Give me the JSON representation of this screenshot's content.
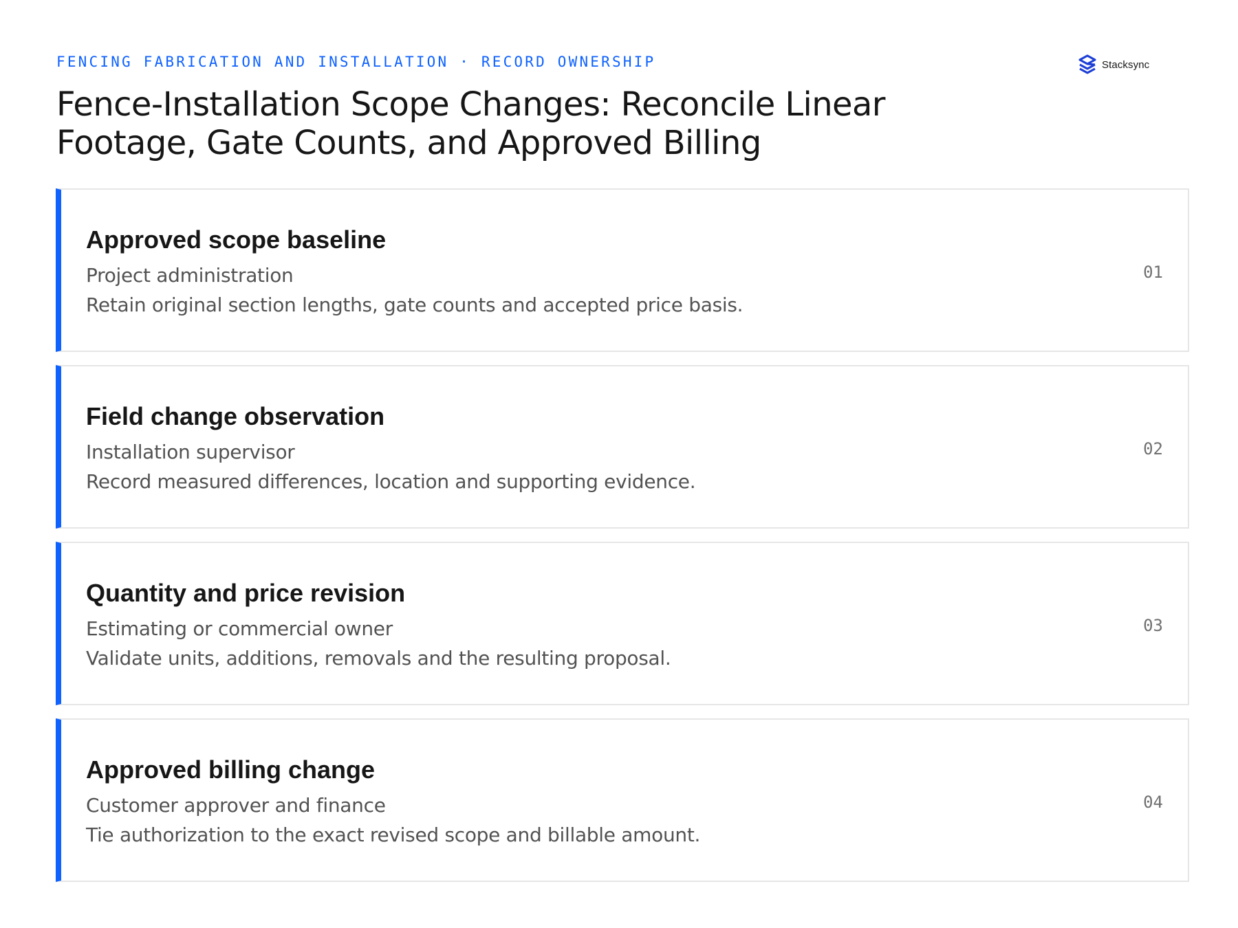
{
  "header": {
    "eyebrow": "FENCING FABRICATION AND INSTALLATION · RECORD OWNERSHIP",
    "title": "Fence-Installation Scope Changes: Reconcile Linear Footage, Gate Counts, and Approved Billing"
  },
  "brand": {
    "name": "Stacksync",
    "icon": "stacksync-logo-icon",
    "accent_color": "#0f62fe"
  },
  "steps": [
    {
      "number": "01",
      "title": "Approved scope baseline",
      "owner": "Project administration",
      "description": "Retain original section lengths, gate counts and accepted price basis."
    },
    {
      "number": "02",
      "title": "Field change observation",
      "owner": "Installation supervisor",
      "description": "Record measured differences, location and supporting evidence."
    },
    {
      "number": "03",
      "title": "Quantity and price revision",
      "owner": "Estimating or commercial owner",
      "description": "Validate units, additions, removals and the resulting proposal."
    },
    {
      "number": "04",
      "title": "Approved billing change",
      "owner": "Customer approver and finance",
      "description": "Tie authorization to the exact revised scope and billable amount."
    }
  ]
}
